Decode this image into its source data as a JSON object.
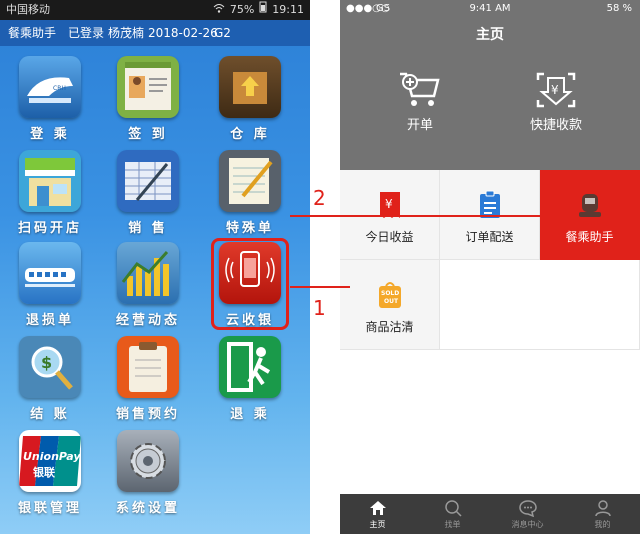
{
  "left": {
    "status": {
      "carrier": "中国移动",
      "battery": "75%",
      "time": "19:11"
    },
    "header": {
      "app": "餐乘助手",
      "login": "已登录",
      "user": "杨茂楠",
      "date": "2018-02-26",
      "train": "G2"
    },
    "items": [
      {
        "label": "登 乘",
        "icon": "train-icon"
      },
      {
        "label": "签 到",
        "icon": "contact-card-icon"
      },
      {
        "label": "仓 库",
        "icon": "warehouse-box-icon"
      },
      {
        "label": "扫码开店",
        "icon": "shop-icon"
      },
      {
        "label": "销 售",
        "icon": "sales-ledger-icon"
      },
      {
        "label": "特殊单",
        "icon": "notepad-icon"
      },
      {
        "label": "退损单",
        "icon": "train-return-icon"
      },
      {
        "label": "经营动态",
        "icon": "bar-chart-icon"
      },
      {
        "label": "云收银",
        "icon": "cloud-cashier-icon"
      },
      {
        "label": "结 账",
        "icon": "magnifier-dollar-icon"
      },
      {
        "label": "销售预约",
        "icon": "clipboard-icon"
      },
      {
        "label": "退 乘",
        "icon": "exit-icon"
      },
      {
        "label": "银联管理",
        "icon": "unionpay-icon"
      },
      {
        "label": "系统设置",
        "icon": "gear-icon"
      }
    ]
  },
  "right": {
    "status": {
      "carrier": "GS",
      "time": "9:41 AM",
      "battery": "58 %"
    },
    "title": "主页",
    "top_buttons": [
      {
        "label": "开单",
        "icon": "cart-add-icon"
      },
      {
        "label": "快捷收款",
        "icon": "yen-download-icon"
      }
    ],
    "cells": [
      {
        "label": "今日收益",
        "icon": "yen-receipt-icon"
      },
      {
        "label": "订单配送",
        "icon": "order-doc-icon"
      },
      {
        "label": "餐乘助手",
        "icon": "train-assistant-icon"
      },
      {
        "label": "商品沽清",
        "icon": "sold-out-icon"
      }
    ],
    "sold_out_text_1": "SOLD",
    "sold_out_text_2": "OUT",
    "tabs": [
      {
        "label": "主页",
        "icon": "home-icon"
      },
      {
        "label": "找单",
        "icon": "search-icon"
      },
      {
        "label": "消息中心",
        "icon": "message-icon"
      },
      {
        "label": "我的",
        "icon": "profile-icon"
      }
    ]
  },
  "callouts": {
    "one": "1",
    "two": "2"
  },
  "colors": {
    "accent": "#e0221a",
    "left_header": "#1e5fb1",
    "right_top": "#737373"
  }
}
